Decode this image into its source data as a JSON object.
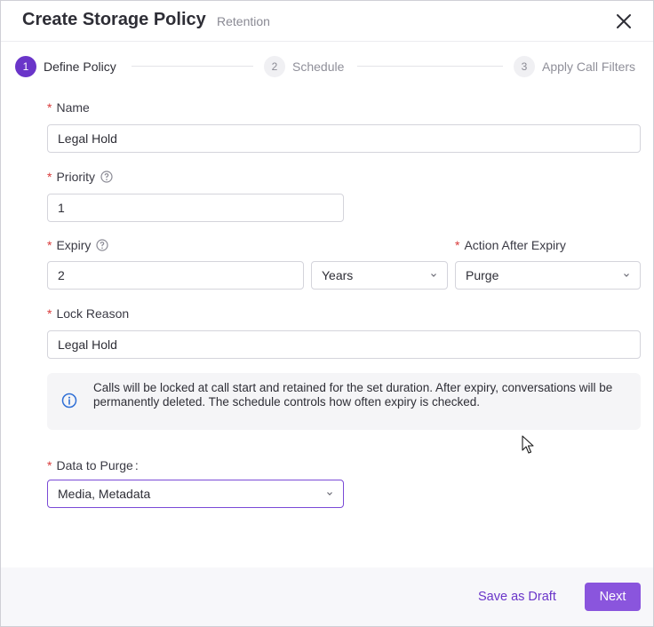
{
  "header": {
    "title": "Create Storage Policy",
    "subtitle": "Retention"
  },
  "stepper": {
    "steps": [
      {
        "number": "1",
        "label": "Define Policy",
        "state": "active"
      },
      {
        "number": "2",
        "label": "Schedule",
        "state": "inactive"
      },
      {
        "number": "3",
        "label": "Apply Call Filters",
        "state": "inactive"
      }
    ]
  },
  "form": {
    "required_mark": "*",
    "name": {
      "label": "Name",
      "value": "Legal Hold"
    },
    "priority": {
      "label": "Priority",
      "value": "1"
    },
    "expiry": {
      "label": "Expiry",
      "value": "2",
      "unit": "Years"
    },
    "action_after_expiry": {
      "label": "Action After Expiry",
      "value": "Purge"
    },
    "lock_reason": {
      "label": "Lock Reason",
      "value": "Legal Hold"
    },
    "data_to_purge": {
      "label": "Data to Purge",
      "label_suffix": ":",
      "value": "Media, Metadata"
    }
  },
  "info": {
    "text": "Calls will be locked at call start and retained for the set duration. After expiry, conversations will be permanently deleted. The schedule controls how often expiry is checked."
  },
  "footer": {
    "draft_label": "Save as Draft",
    "next_label": "Next"
  },
  "colors": {
    "accent": "#6a35c9",
    "button": "#8a55dd",
    "required": "#d93a3a",
    "info_icon": "#2f6fd6"
  },
  "icons": [
    "close-icon",
    "help-circle-icon",
    "chevron-down-icon",
    "info-circle-icon",
    "mouse-cursor-icon"
  ]
}
